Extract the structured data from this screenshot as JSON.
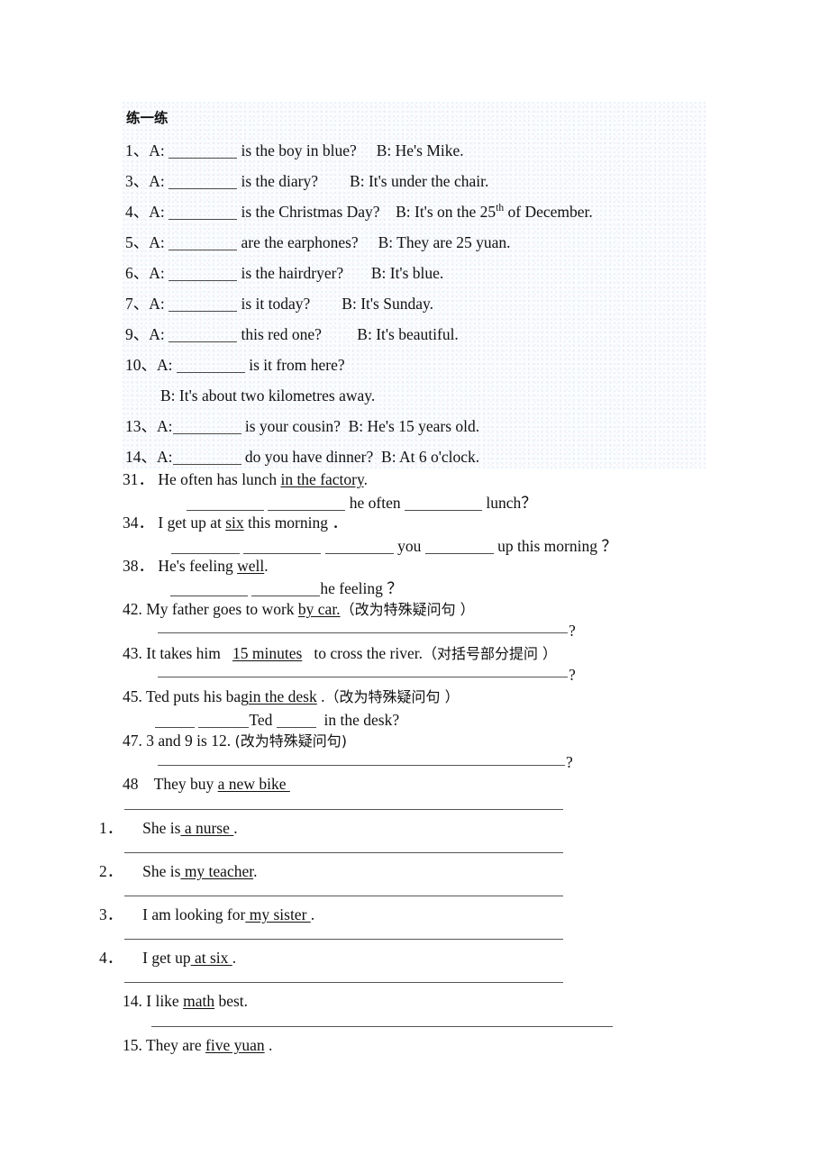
{
  "document": {
    "heading": "练一练",
    "section_a": {
      "items": [
        {
          "num": "1、",
          "speaker_a": "A:",
          "q_tail": "is the boy in blue?",
          "speaker_b": "B: He's Mike."
        },
        {
          "num": "3、",
          "speaker_a": "A:",
          "q_tail": "is the diary?",
          "speaker_b": "B: It's under the chair."
        },
        {
          "num": "4、",
          "speaker_a": "A:",
          "q_tail": "is the Christmas Day?",
          "speaker_b_pre": "B: It's on the 25",
          "speaker_b_sup": "th",
          "speaker_b_post": " of December."
        },
        {
          "num": "5、",
          "speaker_a": "A:",
          "q_tail": "are the earphones?",
          "speaker_b": "B: They are 25 yuan."
        },
        {
          "num": "6、",
          "speaker_a": "A:",
          "q_tail": "is the hairdryer?",
          "speaker_b": "B: It's blue."
        },
        {
          "num": "7、",
          "speaker_a": "A:",
          "q_tail": "is it today?",
          "speaker_b": "B: It's Sunday."
        },
        {
          "num": "9、",
          "speaker_a": "A:",
          "q_tail": "this red one?",
          "speaker_b": "B: It's beautiful."
        },
        {
          "num": "10、",
          "speaker_a": "A:",
          "q_tail": "is it from here?",
          "speaker_b": ""
        },
        {
          "num": "13、",
          "speaker_a": "A:",
          "q_tail": "is your cousin?",
          "speaker_b": "B: He's 15 years old."
        },
        {
          "num": "14、",
          "speaker_a": "A:",
          "q_tail": "do you have dinner?",
          "speaker_b": "B: At 6 o'clock."
        }
      ],
      "item10_answer": "B: It's about two kilometres away."
    },
    "section_b": {
      "i31": {
        "num": "31．",
        "sentence_pre": "He often has lunch ",
        "underlined": "in the factory",
        "sentence_post": ".",
        "answer_mid": "he often",
        "answer_tail": "lunch？"
      },
      "i34": {
        "num": "34．",
        "sentence_pre": "I get up at ",
        "underlined": "six",
        "sentence_post": " this morning ．",
        "answer_mid": "you",
        "answer_tail": "up this morning ？"
      },
      "i38": {
        "num": "38．",
        "sentence_pre": "He's feeling ",
        "underlined": "well",
        "sentence_post": ".",
        "answer_tail": "he feeling ？"
      },
      "i42": {
        "num": "42.",
        "sentence_pre": "My father goes to work ",
        "underlined": "by car.",
        "instruction": "（改为特殊疑问句 ）",
        "answer_mark": "?"
      },
      "i43": {
        "num": "43.",
        "sentence_pre": "It takes him   ",
        "underlined": "15 minutes",
        "sentence_post": "   to cross the river.",
        "instruction": "（对括号部分提问 ）",
        "answer_mark": "?"
      },
      "i45": {
        "num": "45.",
        "sentence_pre": "Ted puts his bag",
        "underlined": "in the desk",
        "sentence_post": " .",
        "instruction": "（改为特殊疑问句 ）",
        "answer_name": "Ted",
        "answer_tail": "in the desk?"
      },
      "i47": {
        "num": "47.",
        "sentence": "3 and 9 is 12.",
        "instruction": "(改为特殊疑问句)",
        "answer_mark": "?"
      },
      "i48": {
        "num": "48",
        "sentence_pre": "They buy ",
        "underlined": "a new bike "
      }
    },
    "section_c": {
      "items": [
        {
          "num": "1．",
          "pre": "She is",
          "underlined": " a nurse ",
          "post": "."
        },
        {
          "num": "2．",
          "pre": "She is",
          "underlined": " my teacher",
          "post": "."
        },
        {
          "num": "3．",
          "pre": "I am looking for",
          "underlined": " my sister ",
          "post": "."
        },
        {
          "num": "4．",
          "pre": "I get up",
          "underlined": " at six ",
          "post": "."
        },
        {
          "num": "14.",
          "pre": "I like ",
          "underlined": "math",
          "post": " best."
        },
        {
          "num": "15.",
          "pre": "They are ",
          "underlined": "five yuan",
          "post": " ."
        }
      ]
    }
  }
}
